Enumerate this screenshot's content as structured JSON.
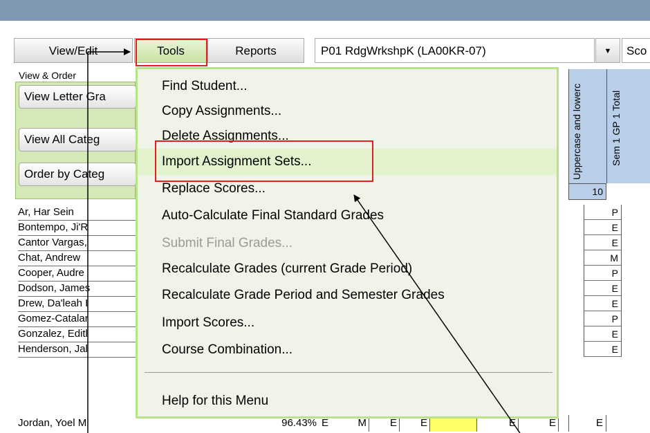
{
  "toolbar": {
    "view_edit": "View/Edit",
    "tools": "Tools",
    "reports": "Reports",
    "course": "P01  RdgWrkshpK (LA00KR-07)",
    "dropdown_arrow": "▼",
    "truncated": "Sco"
  },
  "side_panel": {
    "tab_label": "View & Order",
    "buttons": [
      "View Letter Gra",
      "View All Categ",
      "Order by Categ"
    ]
  },
  "columns": {
    "col1": "Uppercase and lowerc",
    "col2": "Sem 1 GP 1 Total",
    "points": "10"
  },
  "menu": {
    "items": [
      {
        "label": "Find Student..."
      },
      {
        "label": "Copy Assignments..."
      },
      {
        "label": "Delete Assignments..."
      },
      {
        "label": "Import Assignment Sets..."
      },
      {
        "label": "Replace Scores..."
      },
      {
        "label": "Auto-Calculate Final Standard Grades"
      },
      {
        "label": "Submit Final Grades..."
      },
      {
        "label": "Recalculate Grades (current Grade Period)"
      },
      {
        "label": "Recalculate Grade Period and Semester Grades"
      },
      {
        "label": "Import Scores..."
      },
      {
        "label": "Course Combination..."
      },
      {
        "label": "Help for this Menu"
      }
    ]
  },
  "students": [
    {
      "name": "Ar, Har Sein",
      "score": "P"
    },
    {
      "name": "Bontempo, Ji'R",
      "score": "E"
    },
    {
      "name": "Cantor Vargas,",
      "score": "E"
    },
    {
      "name": "Chat, Andrew",
      "score": "M"
    },
    {
      "name": "Cooper, Audre",
      "score": "P"
    },
    {
      "name": "Dodson, James",
      "score": "E"
    },
    {
      "name": "Drew, Da'leah I",
      "score": "E"
    },
    {
      "name": "Gomez-Catalar",
      "score": "P"
    },
    {
      "name": "Gonzalez, Editl",
      "score": "E"
    },
    {
      "name": "Henderson, Jal",
      "score": "E"
    }
  ],
  "last_row": {
    "name": "Jordan, Yoel M",
    "pct": "96.43%",
    "grade": "E",
    "c1": "M",
    "c2": "E",
    "c3": "E",
    "c4": "E",
    "c5": "E",
    "score": "E"
  }
}
